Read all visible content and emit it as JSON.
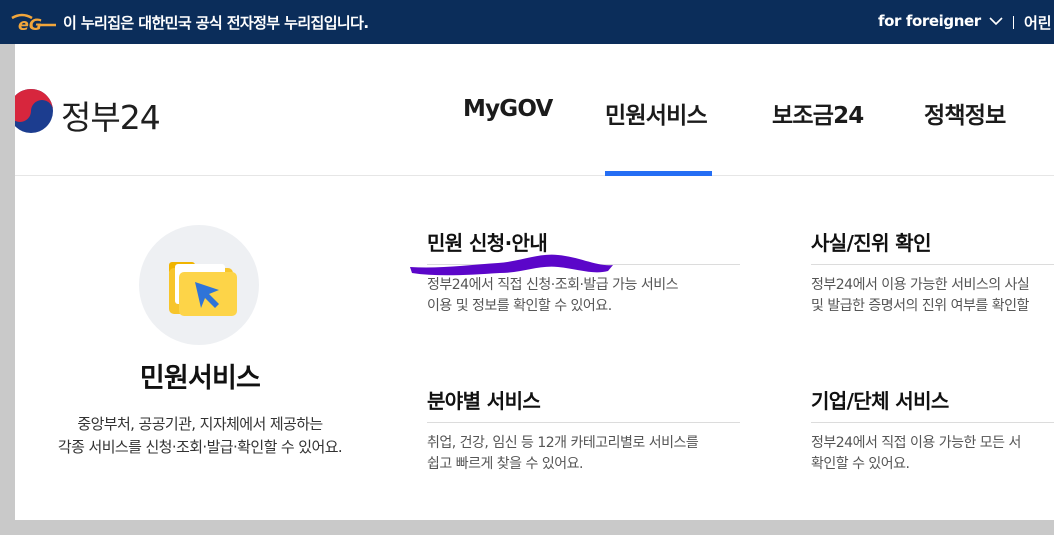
{
  "banner": {
    "text": "이 누리집은 대한민국 공식 전자정부 누리집입니다.",
    "foreigner_label": "for foreigner",
    "lang_label_cut": "어린",
    "colors": {
      "background": "#0b2d5a",
      "logo": "#f2a63b"
    }
  },
  "header": {
    "logo_text": "정부24",
    "nav": [
      {
        "label": "MyGOV"
      },
      {
        "label": "민원서비스",
        "active": true
      },
      {
        "label": "보조금24"
      },
      {
        "label": "정책정보"
      }
    ],
    "accent_color": "#256ef4"
  },
  "dropdown": {
    "intro": {
      "icon": "folder-cursor-icon",
      "title": "민원서비스",
      "desc_line1": "중앙부처, 공공기관, 지자체에서 제공하는",
      "desc_line2": "각종 서비스를 신청·조회·발급·확인할 수 있어요."
    },
    "services": [
      {
        "title": "민원 신청·안내",
        "desc_line1": "정부24에서 직접 신청·조회·발급 가능 서비스",
        "desc_line2": "이용 및 정보를 확인할 수 있어요."
      },
      {
        "title": "사실/진위 확인",
        "desc_line1": "정부24에서 이용 가능한 서비스의 사실",
        "desc_line2": "및 발급한 증명서의 진위 여부를 확인할"
      },
      {
        "title": "분야별 서비스",
        "desc_line1": "취업, 건강, 임신 등 12개 카테고리별로 서비스를",
        "desc_line2": "쉽고 빠르게 찾을 수 있어요."
      },
      {
        "title": "기업/단체 서비스",
        "desc_line1": "정부24에서 직접 이용 가능한 모든 서",
        "desc_line2": "확인할 수 있어요."
      }
    ],
    "annotation_color": "#5b06c9"
  }
}
